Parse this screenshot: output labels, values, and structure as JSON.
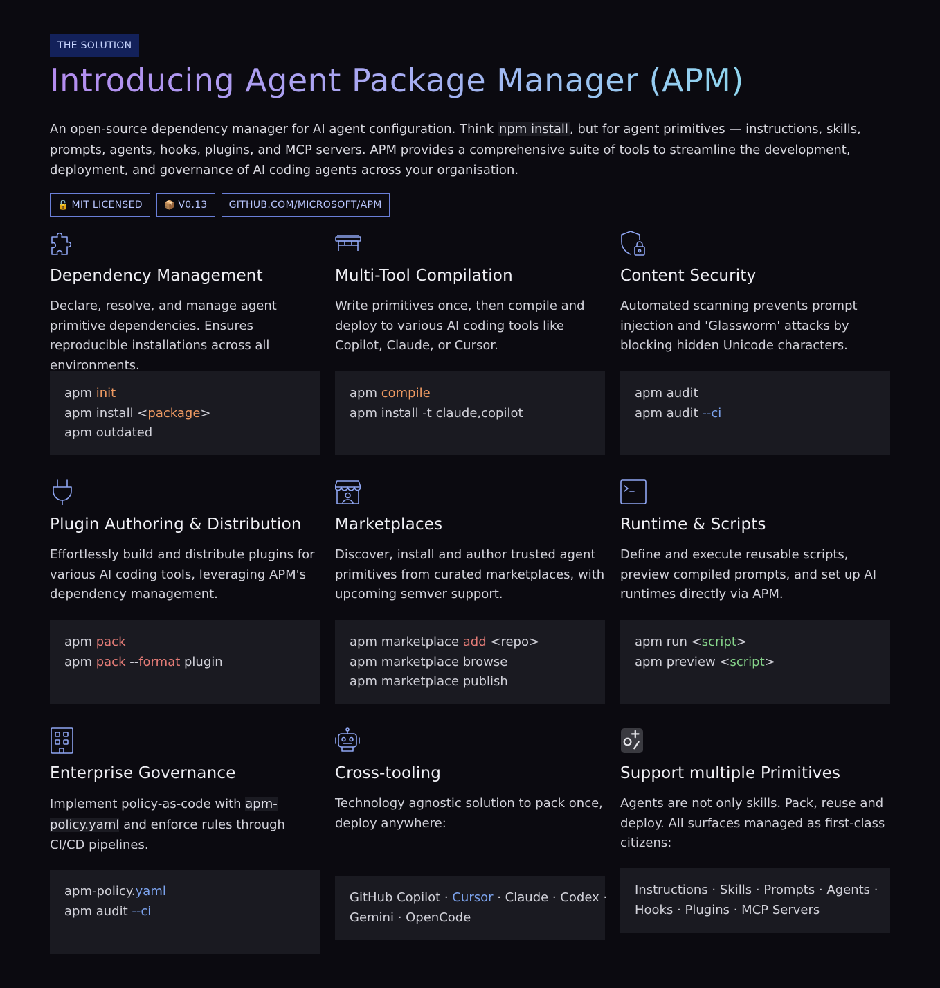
{
  "eyebrow": "THE SOLUTION",
  "title": "Introducing Agent Package Manager (APM)",
  "intro": {
    "part1": "An open-source dependency manager for AI agent configuration. Think ",
    "code": "npm install",
    "part2": ", but for agent primitives — instructions, skills, prompts, agents, hooks, plugins, and MCP servers. APM provides a comprehensive suite of tools to streamline the development, deployment, and governance of AI coding agents across your organisation."
  },
  "badges": [
    {
      "emoji": "🔓",
      "label": "MIT LICENSED"
    },
    {
      "emoji": "📦",
      "label": "V0.13"
    },
    {
      "emoji": "",
      "label": "GITHUB.COM/MICROSOFT/APM"
    }
  ],
  "colors": {
    "accent_orange": "#ee9a62",
    "accent_red": "#e47c77",
    "accent_blue": "#7ca3ee",
    "accent_green": "#86d38a",
    "icon_stroke": "#8fa6f2"
  },
  "cards": [
    {
      "icon": "puzzle-icon",
      "title": "Dependency Management",
      "desc": "Declare, resolve, and manage agent primitive dependencies. Ensures reproducible installations across all environments.",
      "code": [
        [
          {
            "t": "apm "
          },
          {
            "t": "init",
            "c": "o"
          }
        ],
        [
          {
            "t": "apm install <"
          },
          {
            "t": "package",
            "c": "o"
          },
          {
            "t": ">"
          }
        ],
        [
          {
            "t": "apm outdated"
          }
        ]
      ]
    },
    {
      "icon": "workbench-icon",
      "title": "Multi-Tool Compilation",
      "desc": "Write primitives once, then compile and deploy to various AI coding tools like Copilot, Claude, or Cursor.",
      "code": [
        [
          {
            "t": "apm "
          },
          {
            "t": "compile",
            "c": "o"
          }
        ],
        [
          {
            "t": "apm install -t claude,copilot"
          }
        ]
      ]
    },
    {
      "icon": "shield-lock-icon",
      "title": "Content Security",
      "desc": "Automated scanning prevents prompt injection and 'Glassworm' attacks by blocking hidden Unicode characters.",
      "code": [
        [
          {
            "t": "apm audit"
          }
        ],
        [
          {
            "t": "apm audit "
          },
          {
            "t": "--ci",
            "c": "b"
          }
        ]
      ]
    },
    {
      "icon": "plug-icon",
      "title": "Plugin Authoring & Distribution",
      "desc": "Effortlessly build and distribute plugins for various AI coding tools, leveraging APM's dependency management.",
      "code": [
        [
          {
            "t": "apm "
          },
          {
            "t": "pack",
            "c": "r"
          }
        ],
        [
          {
            "t": "apm "
          },
          {
            "t": "pack",
            "c": "r"
          },
          {
            "t": " --"
          },
          {
            "t": "format",
            "c": "r"
          },
          {
            "t": " plugin"
          }
        ]
      ]
    },
    {
      "icon": "storefront-icon",
      "title": "Marketplaces",
      "desc": "Discover, install and author trusted agent primitives from curated marketplaces, with upcoming semver support.",
      "code": [
        [
          {
            "t": "apm marketplace "
          },
          {
            "t": "add",
            "c": "r"
          },
          {
            "t": " <repo>"
          }
        ],
        [
          {
            "t": "apm marketplace browse"
          }
        ],
        [
          {
            "t": "apm marketplace publish"
          }
        ]
      ]
    },
    {
      "icon": "terminal-icon",
      "title": "Runtime & Scripts",
      "desc": "Define and execute reusable scripts, preview compiled prompts, and set up AI runtimes directly via APM.",
      "code": [
        [
          {
            "t": "apm run <"
          },
          {
            "t": "script",
            "c": "g"
          },
          {
            "t": ">"
          }
        ],
        [
          {
            "t": "apm preview <"
          },
          {
            "t": "script",
            "c": "g"
          },
          {
            "t": ">"
          }
        ]
      ]
    },
    {
      "icon": "building-icon",
      "title": "Enterprise Governance",
      "desc_parts": [
        "Implement policy-as-code with ",
        "apm-policy.yaml",
        " and enforce rules through CI/CD pipelines."
      ],
      "code": [
        [
          {
            "t": "apm-policy."
          },
          {
            "t": "yaml",
            "c": "b"
          }
        ],
        [
          {
            "t": "apm audit "
          },
          {
            "t": "--ci",
            "c": "b"
          }
        ]
      ]
    },
    {
      "icon": "robot-icon",
      "title": "Cross-tooling",
      "desc": "Technology agnostic solution to pack once, deploy anywhere:",
      "code": [
        [
          {
            "t": "GitHub Copilot · "
          },
          {
            "t": "Cursor",
            "c": "b"
          },
          {
            "t": " · Claude · Codex ·"
          }
        ],
        [
          {
            "t": "Gemini · OpenCode"
          }
        ]
      ]
    },
    {
      "icon": "primitives-icon",
      "title": "Support multiple Primitives",
      "desc": "Agents are not only skills. Pack, reuse and deploy. All surfaces managed as first-class citizens:",
      "code": [
        [
          {
            "t": "Instructions · Skills · Prompts · Agents ·"
          }
        ],
        [
          {
            "t": "Hooks · Plugins · MCP Servers"
          }
        ]
      ]
    }
  ]
}
